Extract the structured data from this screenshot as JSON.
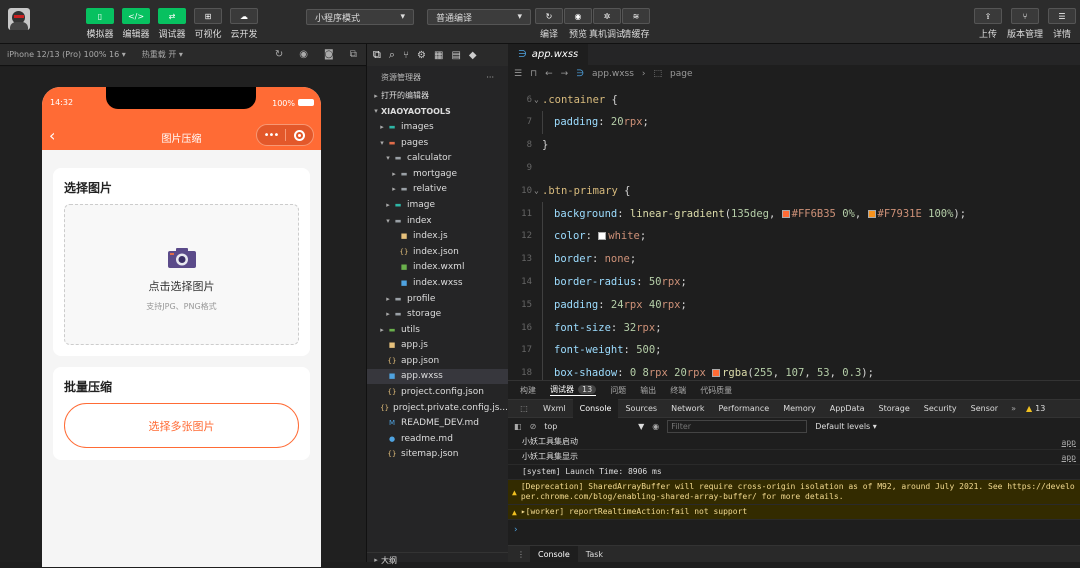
{
  "toolbar": {
    "groups": [
      {
        "label": "模拟器",
        "icon": "phone-icon"
      },
      {
        "label": "编辑器",
        "icon": "code-icon"
      },
      {
        "label": "调试器",
        "icon": "debug-icon"
      },
      {
        "label": "可视化",
        "icon": "layout-icon"
      },
      {
        "label": "云开发",
        "icon": "cloud-icon"
      }
    ],
    "mode_select": "小程序模式",
    "compile_select": "普通编译",
    "mid_buttons": [
      {
        "label": "编译",
        "icon": "refresh-icon"
      },
      {
        "label": "预览",
        "icon": "eye-icon"
      },
      {
        "label": "真机调试",
        "icon": "bug-icon"
      },
      {
        "label": "清缓存",
        "icon": "layers-icon"
      }
    ],
    "right_buttons": [
      {
        "label": "上传",
        "icon": "upload-icon"
      },
      {
        "label": "版本管理",
        "icon": "branch-icon"
      },
      {
        "label": "详情",
        "icon": "menu-icon"
      }
    ]
  },
  "simulator": {
    "device": "iPhone 12/13 (Pro) 100% 16 ▾",
    "hot_reload": "热重载 开 ▾",
    "time": "14:32",
    "battery": "100%",
    "nav_title": "图片压缩",
    "card1": {
      "title": "选择图片",
      "main": "点击选择图片",
      "hint": "支持JPG、PNG格式"
    },
    "card2": {
      "title": "批量压缩",
      "button": "选择多张图片"
    }
  },
  "explorer": {
    "header": "资源管理器",
    "more": "···",
    "open_editors": "打开的编辑器",
    "project": "XIAOYAOTOOLS",
    "outline": "大纲",
    "tree": [
      {
        "name": "images",
        "depth": 1,
        "arrow": "▸",
        "icon": "folder-images-icon",
        "color": "#2eb6a6"
      },
      {
        "name": "pages",
        "depth": 1,
        "arrow": "▾",
        "icon": "folder-pages-icon",
        "color": "#e06c4a"
      },
      {
        "name": "calculator",
        "depth": 2,
        "arrow": "▾",
        "icon": "folder-icon",
        "color": "#9aa0a6"
      },
      {
        "name": "mortgage",
        "depth": 3,
        "arrow": "▸",
        "icon": "folder-icon",
        "color": "#9aa0a6"
      },
      {
        "name": "relative",
        "depth": 3,
        "arrow": "▸",
        "icon": "folder-icon",
        "color": "#9aa0a6"
      },
      {
        "name": "image",
        "depth": 2,
        "arrow": "▸",
        "icon": "folder-images-icon",
        "color": "#2eb6a6"
      },
      {
        "name": "index",
        "depth": 2,
        "arrow": "▾",
        "icon": "folder-icon",
        "color": "#9aa0a6"
      },
      {
        "name": "index.js",
        "depth": 3,
        "arrow": "",
        "icon": "js-file-icon",
        "color": "#e5c07b"
      },
      {
        "name": "index.json",
        "depth": 3,
        "arrow": "",
        "icon": "json-file-icon",
        "color": "#e5c07b"
      },
      {
        "name": "index.wxml",
        "depth": 3,
        "arrow": "",
        "icon": "wxml-file-icon",
        "color": "#6ab04c"
      },
      {
        "name": "index.wxss",
        "depth": 3,
        "arrow": "",
        "icon": "wxss-file-icon",
        "color": "#4fa3e0"
      },
      {
        "name": "profile",
        "depth": 2,
        "arrow": "▸",
        "icon": "folder-icon",
        "color": "#9aa0a6"
      },
      {
        "name": "storage",
        "depth": 2,
        "arrow": "▸",
        "icon": "folder-icon",
        "color": "#9aa0a6"
      },
      {
        "name": "utils",
        "depth": 1,
        "arrow": "▸",
        "icon": "folder-utils-icon",
        "color": "#6ab04c"
      },
      {
        "name": "app.js",
        "depth": 1,
        "arrow": "",
        "icon": "js-file-icon",
        "color": "#e5c07b"
      },
      {
        "name": "app.json",
        "depth": 1,
        "arrow": "",
        "icon": "json-file-icon",
        "color": "#e5c07b"
      },
      {
        "name": "app.wxss",
        "depth": 1,
        "arrow": "",
        "icon": "wxss-file-icon",
        "color": "#4fa3e0"
      },
      {
        "name": "project.config.json",
        "depth": 1,
        "arrow": "",
        "icon": "json-file-icon",
        "color": "#e5c07b"
      },
      {
        "name": "project.private.config.js...",
        "depth": 1,
        "arrow": "",
        "icon": "json-file-icon",
        "color": "#e5c07b"
      },
      {
        "name": "README_DEV.md",
        "depth": 1,
        "arrow": "",
        "icon": "markdown-file-icon",
        "color": "#4fa3e0"
      },
      {
        "name": "readme.md",
        "depth": 1,
        "arrow": "",
        "icon": "info-file-icon",
        "color": "#4fa3e0"
      },
      {
        "name": "sitemap.json",
        "depth": 1,
        "arrow": "",
        "icon": "json-file-icon",
        "color": "#e5c07b"
      }
    ]
  },
  "editor": {
    "tab": "app.wxss",
    "breadcrumb_file": "app.wxss",
    "breadcrumb_sym": "page",
    "lines": [
      {
        "n": "6",
        "fold": "⌄",
        "indent": false,
        "t": [
          {
            "c": "#d7ba7d",
            "s": ".container"
          },
          {
            "c": "#d4d4d4",
            "s": " {"
          }
        ]
      },
      {
        "n": "7",
        "fold": "",
        "indent": true,
        "t": [
          {
            "c": "#9cdcfe",
            "s": "padding"
          },
          {
            "c": "#d4d4d4",
            "s": ": "
          },
          {
            "c": "#b5cea8",
            "s": "20"
          },
          {
            "c": "#ce9178",
            "s": "rpx"
          },
          {
            "c": "#d4d4d4",
            "s": ";"
          }
        ]
      },
      {
        "n": "8",
        "fold": "",
        "indent": false,
        "t": [
          {
            "c": "#d4d4d4",
            "s": "}"
          }
        ]
      },
      {
        "n": "9",
        "fold": "",
        "indent": false,
        "t": []
      },
      {
        "n": "10",
        "fold": "⌄",
        "indent": false,
        "t": [
          {
            "c": "#d7ba7d",
            "s": ".btn-primary"
          },
          {
            "c": "#d4d4d4",
            "s": " {"
          }
        ]
      },
      {
        "n": "11",
        "fold": "",
        "indent": true,
        "t": [
          {
            "c": "#9cdcfe",
            "s": "background"
          },
          {
            "c": "#d4d4d4",
            "s": ": "
          },
          {
            "c": "#dcdcaa",
            "s": "linear-gradient"
          },
          {
            "c": "#d4d4d4",
            "s": "("
          },
          {
            "c": "#b5cea8",
            "s": "135deg"
          },
          {
            "c": "#d4d4d4",
            "s": ", "
          },
          {
            "sw": "#FF6B35"
          },
          {
            "c": "#ce9178",
            "s": "#FF6B35"
          },
          {
            "c": "#d4d4d4",
            "s": " "
          },
          {
            "c": "#b5cea8",
            "s": "0%"
          },
          {
            "c": "#d4d4d4",
            "s": ", "
          },
          {
            "sw": "#F7931E"
          },
          {
            "c": "#ce9178",
            "s": "#F7931E"
          },
          {
            "c": "#d4d4d4",
            "s": " "
          },
          {
            "c": "#b5cea8",
            "s": "100%"
          },
          {
            "c": "#d4d4d4",
            "s": ");"
          }
        ]
      },
      {
        "n": "12",
        "fold": "",
        "indent": true,
        "t": [
          {
            "c": "#9cdcfe",
            "s": "color"
          },
          {
            "c": "#d4d4d4",
            "s": ": "
          },
          {
            "sw": "#FFFFFF"
          },
          {
            "c": "#ce9178",
            "s": "white"
          },
          {
            "c": "#d4d4d4",
            "s": ";"
          }
        ]
      },
      {
        "n": "13",
        "fold": "",
        "indent": true,
        "t": [
          {
            "c": "#9cdcfe",
            "s": "border"
          },
          {
            "c": "#d4d4d4",
            "s": ": "
          },
          {
            "c": "#ce9178",
            "s": "none"
          },
          {
            "c": "#d4d4d4",
            "s": ";"
          }
        ]
      },
      {
        "n": "14",
        "fold": "",
        "indent": true,
        "t": [
          {
            "c": "#9cdcfe",
            "s": "border-radius"
          },
          {
            "c": "#d4d4d4",
            "s": ": "
          },
          {
            "c": "#b5cea8",
            "s": "50"
          },
          {
            "c": "#ce9178",
            "s": "rpx"
          },
          {
            "c": "#d4d4d4",
            "s": ";"
          }
        ]
      },
      {
        "n": "15",
        "fold": "",
        "indent": true,
        "t": [
          {
            "c": "#9cdcfe",
            "s": "padding"
          },
          {
            "c": "#d4d4d4",
            "s": ": "
          },
          {
            "c": "#b5cea8",
            "s": "24"
          },
          {
            "c": "#ce9178",
            "s": "rpx"
          },
          {
            "c": "#d4d4d4",
            "s": " "
          },
          {
            "c": "#b5cea8",
            "s": "40"
          },
          {
            "c": "#ce9178",
            "s": "rpx"
          },
          {
            "c": "#d4d4d4",
            "s": ";"
          }
        ]
      },
      {
        "n": "16",
        "fold": "",
        "indent": true,
        "t": [
          {
            "c": "#9cdcfe",
            "s": "font-size"
          },
          {
            "c": "#d4d4d4",
            "s": ": "
          },
          {
            "c": "#b5cea8",
            "s": "32"
          },
          {
            "c": "#ce9178",
            "s": "rpx"
          },
          {
            "c": "#d4d4d4",
            "s": ";"
          }
        ]
      },
      {
        "n": "17",
        "fold": "",
        "indent": true,
        "t": [
          {
            "c": "#9cdcfe",
            "s": "font-weight"
          },
          {
            "c": "#d4d4d4",
            "s": ": "
          },
          {
            "c": "#b5cea8",
            "s": "500"
          },
          {
            "c": "#d4d4d4",
            "s": ";"
          }
        ]
      },
      {
        "n": "18",
        "fold": "",
        "indent": true,
        "t": [
          {
            "c": "#9cdcfe",
            "s": "box-shadow"
          },
          {
            "c": "#d4d4d4",
            "s": ": "
          },
          {
            "c": "#b5cea8",
            "s": "0"
          },
          {
            "c": "#d4d4d4",
            "s": " "
          },
          {
            "c": "#b5cea8",
            "s": "8"
          },
          {
            "c": "#ce9178",
            "s": "rpx"
          },
          {
            "c": "#d4d4d4",
            "s": " "
          },
          {
            "c": "#b5cea8",
            "s": "20"
          },
          {
            "c": "#ce9178",
            "s": "rpx"
          },
          {
            "c": "#d4d4d4",
            "s": " "
          },
          {
            "sw": "#FF6B35"
          },
          {
            "c": "#dcdcaa",
            "s": "rgba"
          },
          {
            "c": "#d4d4d4",
            "s": "("
          },
          {
            "c": "#b5cea8",
            "s": "255"
          },
          {
            "c": "#d4d4d4",
            "s": ", "
          },
          {
            "c": "#b5cea8",
            "s": "107"
          },
          {
            "c": "#d4d4d4",
            "s": ", "
          },
          {
            "c": "#b5cea8",
            "s": "53"
          },
          {
            "c": "#d4d4d4",
            "s": ", "
          },
          {
            "c": "#b5cea8",
            "s": "0.3"
          },
          {
            "c": "#d4d4d4",
            "s": ");"
          }
        ]
      }
    ]
  },
  "bottom": {
    "panel_tabs": [
      "构建",
      "调试器",
      "问题",
      "输出",
      "终端",
      "代码质量"
    ],
    "debugger_badge": "13",
    "devtabs": [
      "Wxml",
      "Console",
      "Sources",
      "Network",
      "Performance",
      "Memory",
      "AppData",
      "Storage",
      "Security",
      "Sensor"
    ],
    "more": "»",
    "warn_count": "13",
    "context": "top",
    "filter_placeholder": "Filter",
    "levels": "Default levels ▾",
    "logs": [
      {
        "text": "小妖工具集启动",
        "src": "app",
        "kind": "log"
      },
      {
        "text": "小妖工具集显示",
        "src": "app",
        "kind": "log"
      },
      {
        "text": "[system] Launch Time: 8906 ms",
        "src": "",
        "kind": "log"
      },
      {
        "text": "[Deprecation] SharedArrayBuffer will require cross-origin isolation as of M92, around July 2021. See https://developer.chrome.com/blog/enabling-shared-array-buffer/ for more details.",
        "src": "",
        "kind": "warn"
      },
      {
        "text": "▸[worker] reportRealtimeAction:fail not support",
        "src": "",
        "kind": "warn"
      }
    ],
    "prompt": "›",
    "drawer_tabs": [
      "Console",
      "Task"
    ]
  },
  "colors": {
    "accent": "#ff6b35",
    "green": "#07c160"
  }
}
